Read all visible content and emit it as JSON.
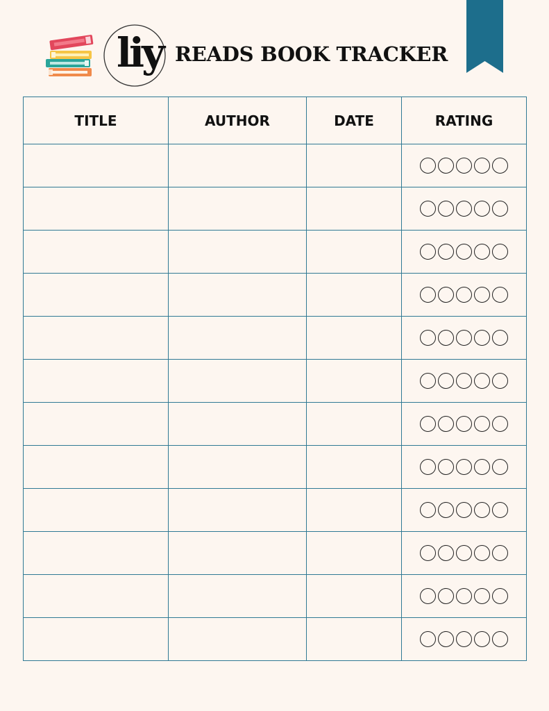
{
  "header": {
    "logo_text": "liy",
    "title": "READS BOOK TRACKER",
    "books_icon": "stack-of-books-icon",
    "bookmark_icon": "bookmark-ribbon-icon"
  },
  "colors": {
    "background": "#fdf6f0",
    "accent": "#1d6e8c",
    "grid_line": "#2f7994",
    "text": "#111111"
  },
  "table": {
    "columns": [
      "TITLE",
      "AUTHOR",
      "DATE",
      "RATING"
    ],
    "rows": [
      {
        "title": "",
        "author": "",
        "date": "",
        "rating": 0
      },
      {
        "title": "",
        "author": "",
        "date": "",
        "rating": 0
      },
      {
        "title": "",
        "author": "",
        "date": "",
        "rating": 0
      },
      {
        "title": "",
        "author": "",
        "date": "",
        "rating": 0
      },
      {
        "title": "",
        "author": "",
        "date": "",
        "rating": 0
      },
      {
        "title": "",
        "author": "",
        "date": "",
        "rating": 0
      },
      {
        "title": "",
        "author": "",
        "date": "",
        "rating": 0
      },
      {
        "title": "",
        "author": "",
        "date": "",
        "rating": 0
      },
      {
        "title": "",
        "author": "",
        "date": "",
        "rating": 0
      },
      {
        "title": "",
        "author": "",
        "date": "",
        "rating": 0
      },
      {
        "title": "",
        "author": "",
        "date": "",
        "rating": 0
      },
      {
        "title": "",
        "author": "",
        "date": "",
        "rating": 0
      }
    ],
    "rating_max": 5
  }
}
